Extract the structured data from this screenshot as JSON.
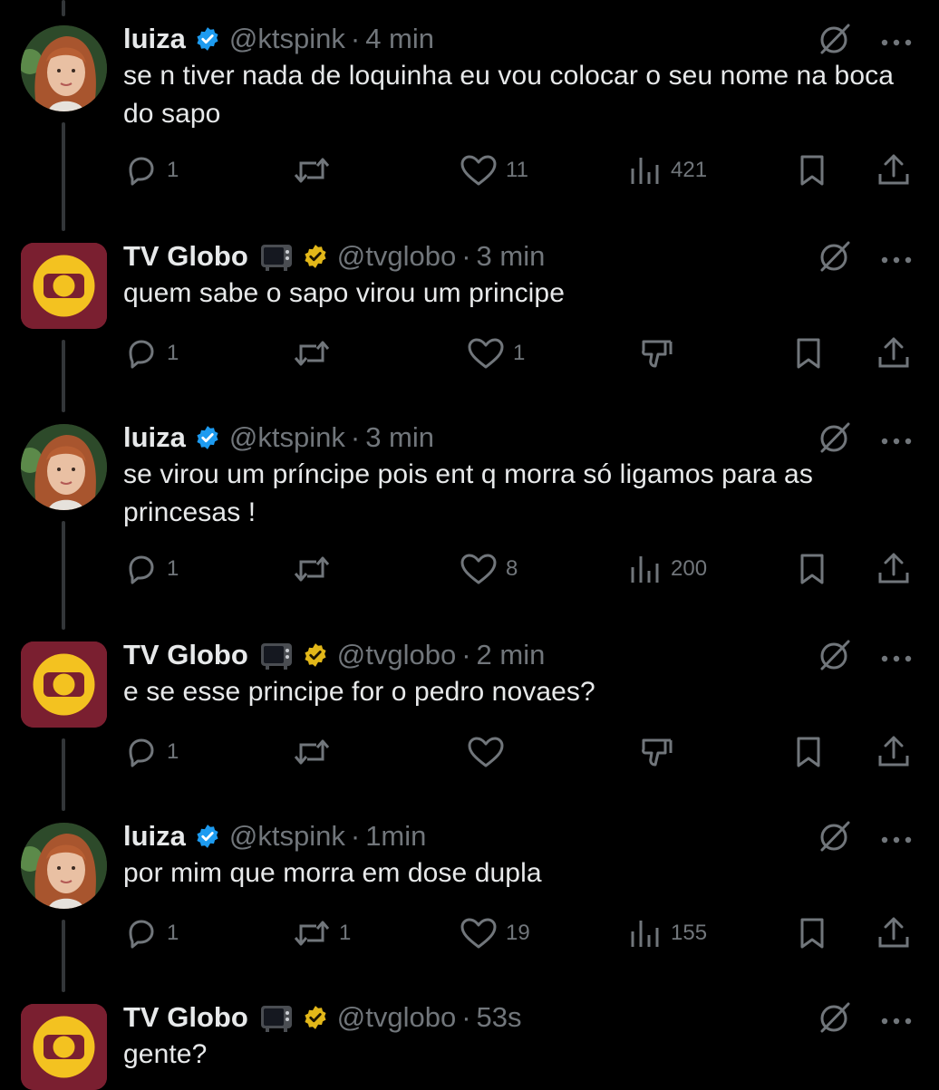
{
  "colors": {
    "background": "#000000",
    "text": "#e7e9ea",
    "muted": "#71767b",
    "verified_blue": "#1d9bf0",
    "verified_gold": "#e2b719",
    "globo_bg": "#7a1f30",
    "globo_ring": "#f3c220"
  },
  "tweets": [
    {
      "name": "luiza",
      "handle": "@ktspink",
      "dot": "·",
      "time": "4 min",
      "text": "se n tiver nada de loquinha eu vou colocar o seu nome na boca do sapo",
      "replies": "1",
      "reposts": "",
      "likes": "11",
      "views": "421",
      "badge": "verified-blue-icon"
    },
    {
      "name": "TV Globo",
      "emoji": "television-emoji-icon",
      "handle": "@tvglobo",
      "dot": "·",
      "time": "3 min",
      "text": "quem sabe o sapo virou um principe",
      "replies": "1",
      "reposts": "",
      "likes": "1",
      "badge": "verified-gold-icon"
    },
    {
      "name": "luiza",
      "handle": "@ktspink",
      "dot": "·",
      "time": "3 min",
      "text": "se virou um príncipe pois ent q morra só ligamos para as princesas !",
      "replies": "1",
      "reposts": "",
      "likes": "8",
      "views": "200",
      "badge": "verified-blue-icon"
    },
    {
      "name": "TV Globo",
      "emoji": "television-emoji-icon",
      "handle": "@tvglobo",
      "dot": "·",
      "time": "2 min",
      "text": "e se esse principe for o pedro novaes?",
      "replies": "1",
      "reposts": "",
      "likes": "",
      "badge": "verified-gold-icon"
    },
    {
      "name": "luiza",
      "handle": "@ktspink",
      "dot": "·",
      "time": "1min",
      "text": "por mim que morra em dose dupla",
      "replies": "1",
      "reposts": "1",
      "likes": "19",
      "views": "155",
      "badge": "verified-blue-icon"
    },
    {
      "name": "TV Globo",
      "emoji": "television-emoji-icon",
      "handle": "@tvglobo",
      "dot": "·",
      "time": "53s",
      "text": "gente?",
      "badge": "verified-gold-icon"
    }
  ]
}
